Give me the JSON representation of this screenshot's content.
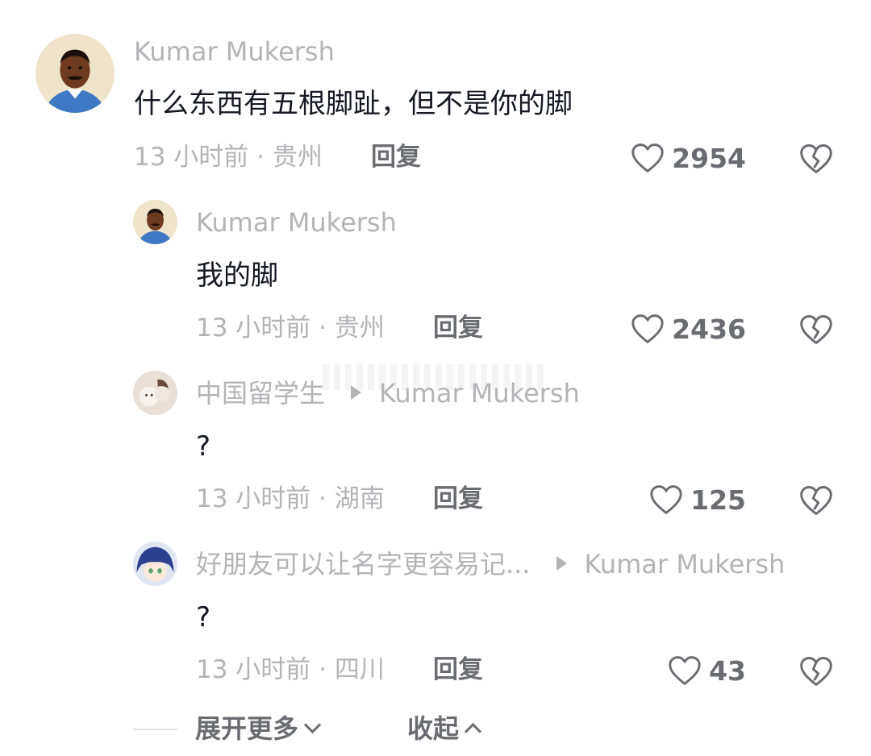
{
  "comments": [
    {
      "username": "Kumar Mukersh",
      "text": "什么东西有五根脚趾，但不是你的脚",
      "time": "13 小时前",
      "location": "贵州",
      "reply_label": "回复",
      "likes": "2954"
    },
    {
      "username": "Kumar Mukersh",
      "text": "我的脚",
      "time": "13 小时前",
      "location": "贵州",
      "reply_label": "回复",
      "likes": "2436"
    },
    {
      "username": "中国留学生",
      "reply_to": "Kumar Mukersh",
      "text": "?",
      "time": "13 小时前",
      "location": "湖南",
      "reply_label": "回复",
      "likes": "125"
    },
    {
      "username": "好朋友可以让名字更容易记...",
      "reply_to": "Kumar Mukersh",
      "text": "?",
      "time": "13 小时前",
      "location": "四川",
      "reply_label": "回复",
      "likes": "43"
    }
  ],
  "footer": {
    "expand_label": "展开更多",
    "collapse_label": "收起"
  },
  "meta_separator": " · ",
  "colors": {
    "username": "#b3b3b8",
    "text": "#161823",
    "action": "#6b6b72"
  },
  "icons": {
    "like": "heart-outline-icon",
    "dislike": "broken-heart-icon",
    "reply_to": "triangle-right-icon",
    "expand": "chevron-down-icon",
    "collapse": "chevron-up-icon"
  }
}
